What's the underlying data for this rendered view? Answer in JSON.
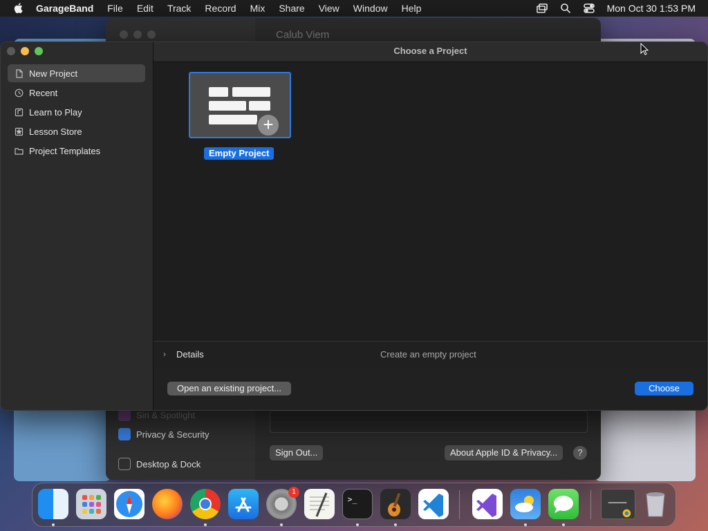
{
  "menubar": {
    "app_name": "GarageBand",
    "menus": [
      "File",
      "Edit",
      "Track",
      "Record",
      "Mix",
      "Share",
      "View",
      "Window",
      "Help"
    ],
    "clock": "Mon Oct 30  1:53 PM",
    "status_icons": [
      "screen-mirroring-icon",
      "spotlight-search-icon",
      "control-center-icon"
    ]
  },
  "background_window": {
    "title": "Calub Viem",
    "sidebar_items": [
      {
        "label": "Siri & Spotlight",
        "icon": "siri-icon",
        "color": "#b04ad8"
      },
      {
        "label": "Privacy & Security",
        "icon": "hand-icon",
        "color": "#3b7de0"
      },
      {
        "label": "Desktop & Dock",
        "icon": "dock-icon",
        "color": "#2e2e2e"
      }
    ],
    "sign_out_label": "Sign Out...",
    "about_label": "About Apple ID & Privacy...",
    "help_label": "?"
  },
  "garageband": {
    "window_title": "Choose a Project",
    "sidebar": [
      {
        "label": "New Project",
        "icon": "document-icon",
        "selected": true
      },
      {
        "label": "Recent",
        "icon": "clock-icon",
        "selected": false
      },
      {
        "label": "Learn to Play",
        "icon": "music-note-icon",
        "selected": false
      },
      {
        "label": "Lesson Store",
        "icon": "star-icon",
        "selected": false
      },
      {
        "label": "Project Templates",
        "icon": "folder-icon",
        "selected": false
      }
    ],
    "project_tile": {
      "label": "Empty Project",
      "icon": "empty-project-icon"
    },
    "details_label": "Details",
    "details_description": "Create an empty project",
    "open_existing_label": "Open an existing project...",
    "choose_label": "Choose",
    "accent_color": "#1a6fe0"
  },
  "dock": {
    "apps": [
      {
        "name": "Finder",
        "icon": "finder-icon",
        "running": true
      },
      {
        "name": "Launchpad",
        "icon": "launchpad-icon",
        "running": false
      },
      {
        "name": "Safari",
        "icon": "safari-icon",
        "running": false
      },
      {
        "name": "Firefox",
        "icon": "firefox-icon",
        "running": false
      },
      {
        "name": "Chrome",
        "icon": "chrome-icon",
        "running": true
      },
      {
        "name": "App Store",
        "icon": "app-store-icon",
        "running": false
      },
      {
        "name": "System Settings",
        "icon": "system-settings-icon",
        "running": true,
        "badge": "1"
      },
      {
        "name": "TextEdit",
        "icon": "textedit-icon",
        "running": false
      },
      {
        "name": "Terminal",
        "icon": "terminal-icon",
        "running": true
      },
      {
        "name": "GarageBand",
        "icon": "garageband-icon",
        "running": true
      },
      {
        "name": "VS Code",
        "icon": "vscode-icon",
        "running": false
      },
      {
        "name": "Visual Studio",
        "icon": "visual-studio-icon",
        "running": false
      },
      {
        "name": "Weather",
        "icon": "weather-icon",
        "running": true
      },
      {
        "name": "Messages",
        "icon": "messages-icon",
        "running": true
      },
      {
        "name": "Chrome Window",
        "icon": "chrome-window-thumbnail-icon",
        "running": false
      },
      {
        "name": "Trash",
        "icon": "trash-icon",
        "running": false
      }
    ]
  }
}
